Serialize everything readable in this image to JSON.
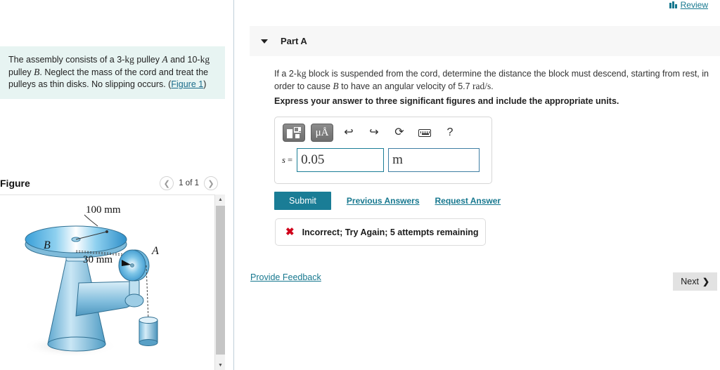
{
  "left": {
    "question_text_parts": {
      "p1": "The assembly consists of a 3-",
      "u1": "kg",
      "p2": " pulley ",
      "v1": "A",
      "p3": " and 10-",
      "u2": "kg",
      "p4": " pulley ",
      "v2": "B",
      "p5": ". Neglect the mass of the cord and treat the pulleys as thin disks. No slipping occurs. (",
      "figure_link": "Figure 1",
      "p6": ")"
    },
    "figure_title": "Figure",
    "pager": {
      "prev_icon": "chevron-left-icon",
      "label": "1 of 1",
      "next_icon": "chevron-right-icon"
    },
    "figure_labels": {
      "dim_top": "100 mm",
      "dim_mid": "30 mm",
      "pulley_b": "B",
      "pulley_a": "A"
    }
  },
  "right": {
    "review": {
      "label": "Review",
      "icon": "bar-chart-icon"
    },
    "part": {
      "title": "Part A",
      "collapse_icon": "caret-down-icon"
    },
    "question": {
      "t1": "If a 2-",
      "u1": "kg",
      "t2": " block is suspended from the cord, determine the distance the block must descend, starting from rest, in order to cause ",
      "v1": "B",
      "t3": " to have an angular velocity of 5.7 ",
      "u2": "rad/s",
      "t4": ".",
      "instruction": "Express your answer to three significant figures and include the appropriate units."
    },
    "answer": {
      "toolbar": [
        {
          "name": "template-button",
          "label": ""
        },
        {
          "name": "units-button",
          "label": "μÅ"
        },
        {
          "name": "undo-icon",
          "label": "↰"
        },
        {
          "name": "redo-icon",
          "label": "↱"
        },
        {
          "name": "reset-icon",
          "label": "↻"
        },
        {
          "name": "keyboard-icon",
          "label": ""
        },
        {
          "name": "help-icon",
          "label": "?"
        }
      ],
      "variable_label": "s",
      "equals": "=",
      "value": "0.05",
      "value_placeholder": "",
      "units": "m",
      "units_placeholder": ""
    },
    "actions": {
      "submit": "Submit",
      "previous_answers": "Previous Answers",
      "request_answer": "Request Answer"
    },
    "alert": {
      "icon": "x-mark-icon",
      "text": "Incorrect; Try Again; 5 attempts remaining"
    },
    "footer": {
      "feedback": "Provide Feedback",
      "next": "Next",
      "next_icon": "chevron-right-icon"
    }
  }
}
